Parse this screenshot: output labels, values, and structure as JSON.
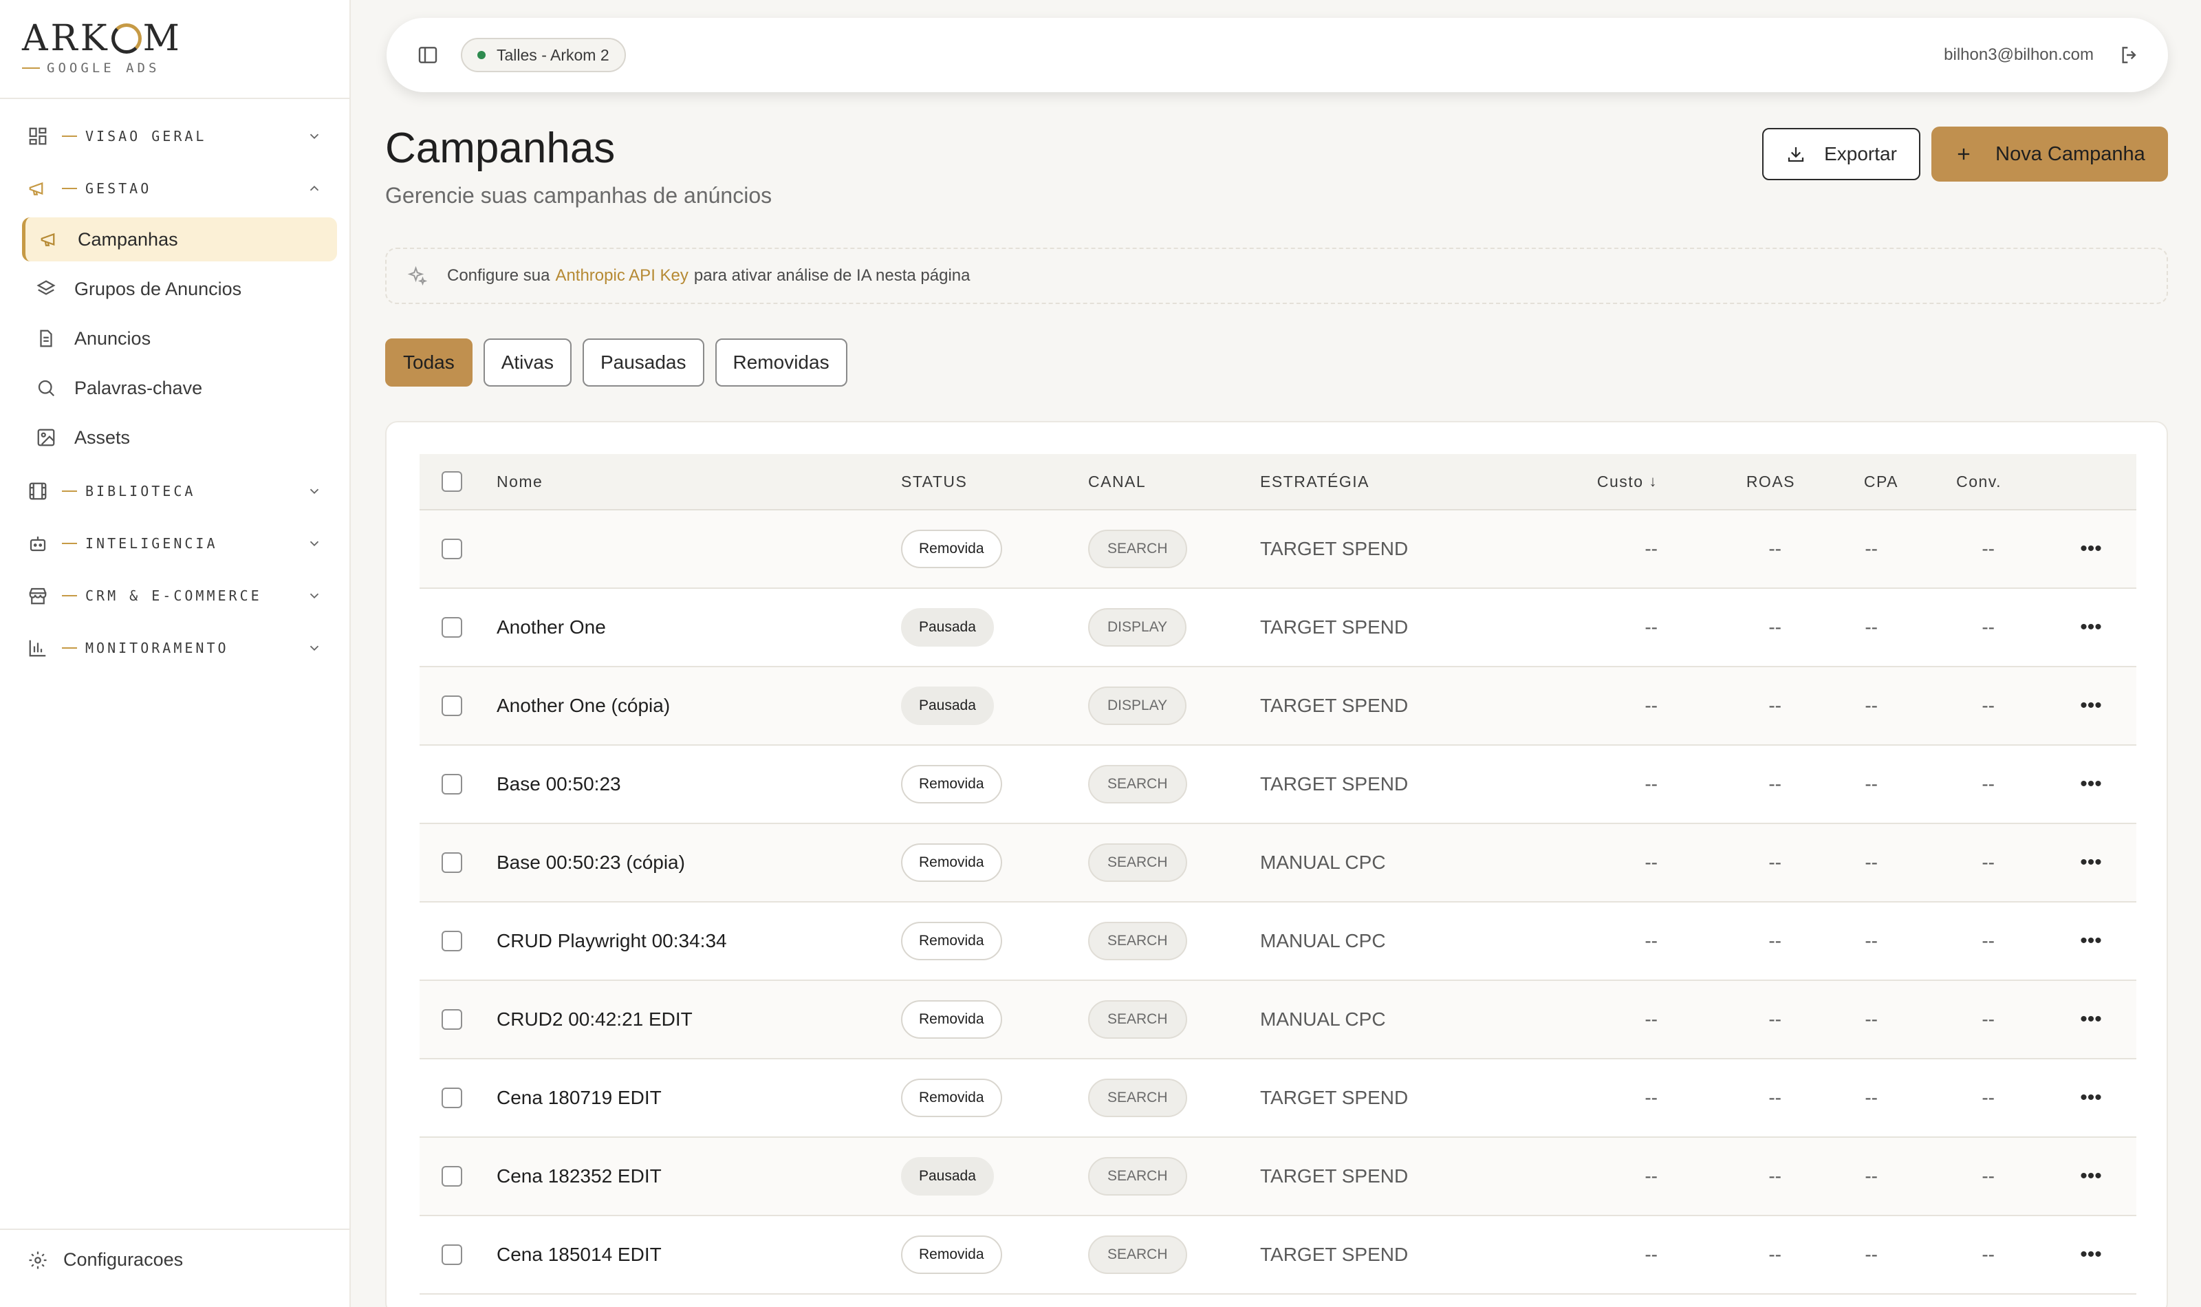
{
  "brand": {
    "name_left": "ARK",
    "name_right": "M",
    "sub": "GOOGLE ADS"
  },
  "nav": {
    "sections": [
      {
        "id": "visao-geral",
        "label": "VISAO GERAL",
        "icon": "grid-icon",
        "expanded": false
      },
      {
        "id": "gestao",
        "label": "GESTAO",
        "icon": "megaphone-icon",
        "expanded": true,
        "items": [
          {
            "label": "Campanhas",
            "icon": "megaphone-icon",
            "active": true
          },
          {
            "label": "Grupos de Anuncios",
            "icon": "layers-icon"
          },
          {
            "label": "Anuncios",
            "icon": "document-icon"
          },
          {
            "label": "Palavras-chave",
            "icon": "search-icon"
          },
          {
            "label": "Assets",
            "icon": "image-icon"
          }
        ]
      },
      {
        "id": "biblioteca",
        "label": "BIBLIOTECA",
        "icon": "film-icon",
        "expanded": false
      },
      {
        "id": "inteligencia",
        "label": "INTELIGENCIA",
        "icon": "robot-icon",
        "expanded": false
      },
      {
        "id": "crm",
        "label": "CRM & E-COMMERCE",
        "icon": "store-icon",
        "expanded": false
      },
      {
        "id": "monitoramento",
        "label": "MONITORAMENTO",
        "icon": "bar-chart-icon",
        "expanded": false
      }
    ],
    "settings_label": "Configuracoes"
  },
  "topbar": {
    "account": "Talles - Arkom 2",
    "account_status_color": "#2e8b4f",
    "user_email": "bilhon3@bilhon.com"
  },
  "header": {
    "title": "Campanhas",
    "subtitle": "Gerencie suas campanhas de anúncios",
    "export_label": "Exportar",
    "new_label": "Nova Campanha"
  },
  "ai_banner": {
    "prefix": "Configure sua",
    "link": "Anthropic API Key",
    "suffix": "para ativar análise de IA nesta página"
  },
  "filters": [
    {
      "label": "Todas",
      "active": true
    },
    {
      "label": "Ativas"
    },
    {
      "label": "Pausadas"
    },
    {
      "label": "Removidas"
    }
  ],
  "table": {
    "columns": {
      "name": "Nome",
      "status": "STATUS",
      "canal": "CANAL",
      "strategy": "ESTRATÉGIA",
      "cost": "Custo",
      "sort_arrow": "↓",
      "roas": "ROAS",
      "cpa": "CPA",
      "conv": "Conv."
    },
    "rows": [
      {
        "name": "",
        "status": "Removida",
        "canal": "SEARCH",
        "strategy": "TARGET SPEND",
        "cost": "--",
        "roas": "--",
        "cpa": "--",
        "conv": "--"
      },
      {
        "name": "Another One",
        "status": "Pausada",
        "canal": "DISPLAY",
        "strategy": "TARGET SPEND",
        "cost": "--",
        "roas": "--",
        "cpa": "--",
        "conv": "--"
      },
      {
        "name": "Another One (cópia)",
        "status": "Pausada",
        "canal": "DISPLAY",
        "strategy": "TARGET SPEND",
        "cost": "--",
        "roas": "--",
        "cpa": "--",
        "conv": "--"
      },
      {
        "name": "Base 00:50:23",
        "status": "Removida",
        "canal": "SEARCH",
        "strategy": "TARGET SPEND",
        "cost": "--",
        "roas": "--",
        "cpa": "--",
        "conv": "--"
      },
      {
        "name": "Base 00:50:23 (cópia)",
        "status": "Removida",
        "canal": "SEARCH",
        "strategy": "MANUAL CPC",
        "cost": "--",
        "roas": "--",
        "cpa": "--",
        "conv": "--"
      },
      {
        "name": "CRUD Playwright 00:34:34",
        "status": "Removida",
        "canal": "SEARCH",
        "strategy": "MANUAL CPC",
        "cost": "--",
        "roas": "--",
        "cpa": "--",
        "conv": "--"
      },
      {
        "name": "CRUD2 00:42:21 EDIT",
        "status": "Removida",
        "canal": "SEARCH",
        "strategy": "MANUAL CPC",
        "cost": "--",
        "roas": "--",
        "cpa": "--",
        "conv": "--"
      },
      {
        "name": "Cena 180719 EDIT",
        "status": "Removida",
        "canal": "SEARCH",
        "strategy": "TARGET SPEND",
        "cost": "--",
        "roas": "--",
        "cpa": "--",
        "conv": "--"
      },
      {
        "name": "Cena 182352 EDIT",
        "status": "Pausada",
        "canal": "SEARCH",
        "strategy": "TARGET SPEND",
        "cost": "--",
        "roas": "--",
        "cpa": "--",
        "conv": "--"
      },
      {
        "name": "Cena 185014 EDIT",
        "status": "Removida",
        "canal": "SEARCH",
        "strategy": "TARGET SPEND",
        "cost": "--",
        "roas": "--",
        "cpa": "--",
        "conv": "--"
      }
    ],
    "more_glyph": "•••"
  },
  "colors": {
    "accent": "#c0904f",
    "accent_soft": "#fbf0d6",
    "link": "#b68a34"
  }
}
